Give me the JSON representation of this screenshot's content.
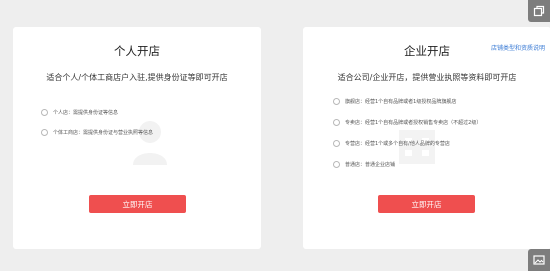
{
  "personal": {
    "title": "个人开店",
    "desc": "适合个人/个体工商店户入驻,提供身份证等即可开店",
    "options": [
      {
        "label": "个人店：需提供身份证等信息"
      },
      {
        "label": "个体工商店：需提供身份证与营业执照等信息"
      }
    ],
    "button_label": "立即开店"
  },
  "enterprise": {
    "title": "企业开店",
    "link_label": "店铺类型和资质说明",
    "desc": "适合公司/企业开店，提供营业执照等资料即可开店",
    "options": [
      {
        "label": "旗舰店：经营1个自有品牌或者1级授权品牌旗舰店"
      },
      {
        "label": "专卖店：经营1个自有品牌或者授权销售专卖店（不超过2级）"
      },
      {
        "label": "专营店：经营1个或多个自有/他人品牌的专营店"
      },
      {
        "label": "普通店：普通企业店铺"
      }
    ],
    "button_label": "立即开店"
  },
  "icons": {
    "top_right": "copy-icon",
    "bottom_right": "image-icon"
  },
  "colors": {
    "background": "#eeeeee",
    "card": "#ffffff",
    "button": "#ef4f4f",
    "link": "#3a7bd5"
  }
}
